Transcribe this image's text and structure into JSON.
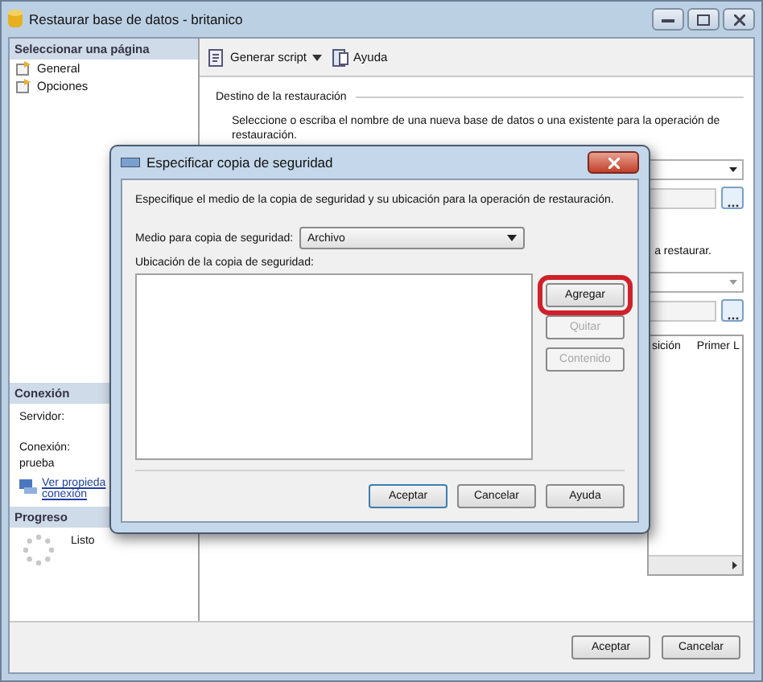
{
  "window": {
    "title": "Restaurar base de datos - britanico"
  },
  "sidebar": {
    "header": "Seleccionar una página",
    "items": [
      {
        "label": "General"
      },
      {
        "label": "Opciones"
      }
    ]
  },
  "connection": {
    "header": "Conexión",
    "server_label": "Servidor:",
    "connection_label": "Conexión:",
    "connection_value": "prueba",
    "link_lines": [
      "Ver propieda",
      "conexión"
    ]
  },
  "progress": {
    "header": "Progreso",
    "status": "Listo"
  },
  "toolbar": {
    "items": [
      {
        "kind": "script",
        "label": "Generar script"
      },
      {
        "kind": "help",
        "label": "Ayuda"
      }
    ]
  },
  "destination": {
    "legend": "Destino de la restauración",
    "description": "Seleccione o escriba el nombre de una nueva base de datos o una existente para la operación de",
    "description_cont": "restauración."
  },
  "source": {
    "partial_text": "a restaurar."
  },
  "grid": {
    "columns": [
      "sición",
      "Primer L"
    ]
  },
  "buttons": [
    {
      "label": "Aceptar"
    },
    {
      "label": "Cancelar"
    }
  ],
  "dialog": {
    "title": "Especificar copia de seguridad",
    "description": "Especifique el medio de la copia de seguridad y su ubicación para la operación de restauración.",
    "media_label": "Medio para copia de seguridad:",
    "media_value": "Archivo",
    "location_label": "Ubicación de la copia de seguridad:",
    "side_buttons": [
      {
        "label": "Agregar",
        "disabled": false,
        "highlighted": true
      },
      {
        "label": "Quitar",
        "disabled": true,
        "highlighted": false
      },
      {
        "label": "Contenido",
        "disabled": true,
        "highlighted": false
      }
    ],
    "buttons": [
      {
        "label": "Aceptar",
        "default": true
      },
      {
        "label": "Cancelar",
        "default": false
      },
      {
        "label": "Ayuda",
        "default": false
      }
    ]
  }
}
